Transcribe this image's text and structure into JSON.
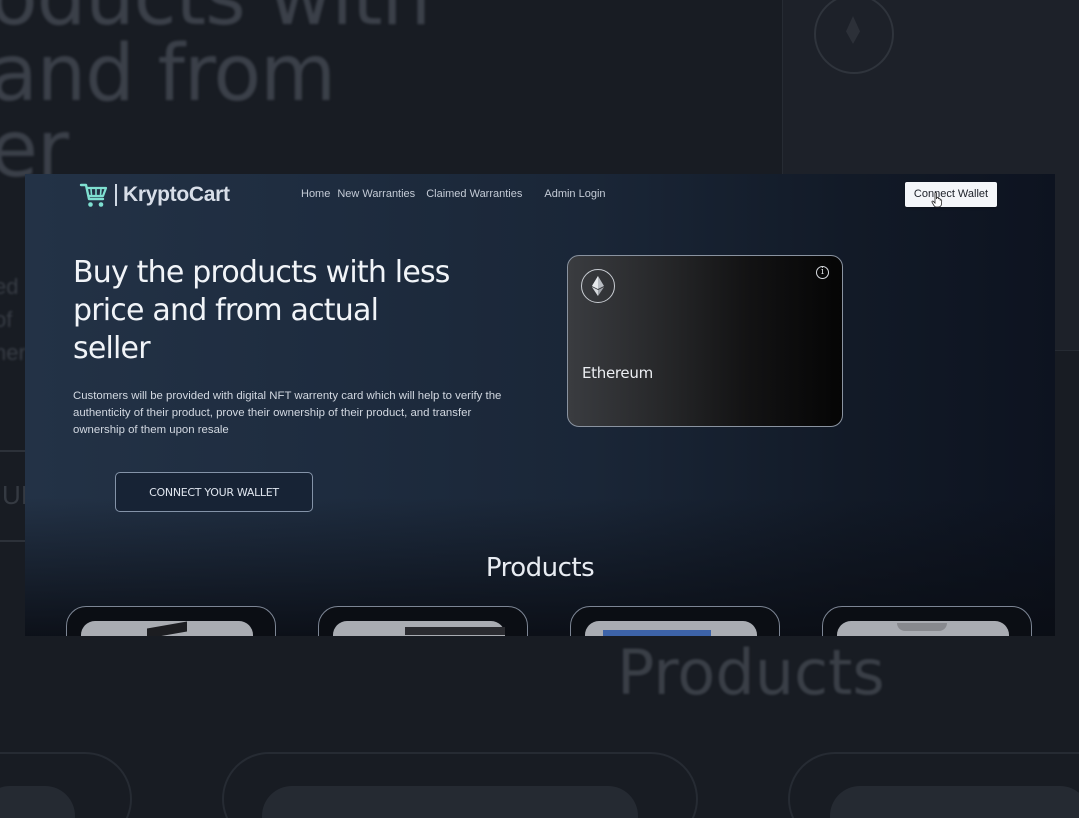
{
  "brand": {
    "name": "KryptoCart"
  },
  "nav": {
    "home": "Home",
    "new_warranties": "New Warranties",
    "claimed_warranties": "Claimed Warranties",
    "admin_login": "Admin Login",
    "connect_wallet": "Connect Wallet"
  },
  "hero": {
    "title": "Buy the products with less price and from actual seller",
    "description": "Customers will be provided with digital NFT warrenty card which will help to verify the authenticity of their product, prove their ownership of their product, and transfer ownership of them upon resale",
    "cta": "CONNECT YOUR WALLET"
  },
  "wallet_card": {
    "network": "Ethereum",
    "logo_icon": "ethereum-icon",
    "info_icon": "info-icon"
  },
  "products": {
    "title": "Products",
    "cards": [
      {
        "image": "product-image"
      },
      {
        "image": "product-image"
      },
      {
        "image": "product-image"
      },
      {
        "image": "product-image"
      }
    ]
  },
  "background": {
    "hero_fragment": "oducts with\nand from\ner",
    "side_fragment": "ed\nof\nner",
    "button_fragment": "UI",
    "products_fragment": "Products"
  },
  "colors": {
    "accent": "#7fe0d1",
    "page_bg": "#181c23",
    "hero_bg": "#1e2c3f",
    "button_light": "#f4f6f9"
  }
}
